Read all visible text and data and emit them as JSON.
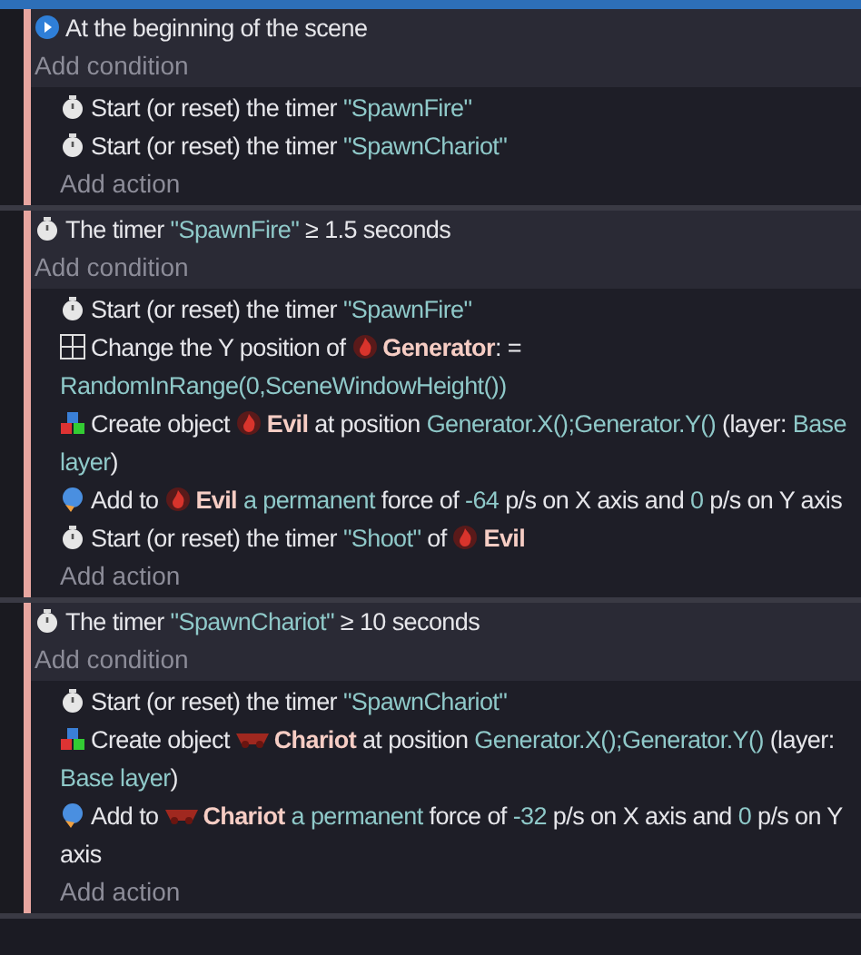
{
  "events": [
    {
      "conditions": [
        {
          "kind": "scene-start",
          "parts": [
            {
              "kind": "text",
              "text": "At the beginning of the scene"
            }
          ]
        }
      ],
      "add_condition": "Add condition",
      "actions": [
        {
          "kind": "timer",
          "parts": [
            {
              "kind": "text",
              "text": "Start (or reset) the timer "
            },
            {
              "kind": "value",
              "text": "\"SpawnFire\""
            }
          ]
        },
        {
          "kind": "timer",
          "parts": [
            {
              "kind": "text",
              "text": "Start (or reset) the timer "
            },
            {
              "kind": "value",
              "text": "\"SpawnChariot\""
            }
          ]
        }
      ],
      "add_action": "Add action"
    },
    {
      "conditions": [
        {
          "kind": "timer",
          "parts": [
            {
              "kind": "text",
              "text": "The timer "
            },
            {
              "kind": "value",
              "text": "\"SpawnFire\""
            },
            {
              "kind": "text",
              "text": " ≥ 1.5 seconds"
            }
          ]
        }
      ],
      "add_condition": "Add condition",
      "actions": [
        {
          "kind": "timer",
          "parts": [
            {
              "kind": "text",
              "text": "Start (or reset) the timer "
            },
            {
              "kind": "value",
              "text": "\"SpawnFire\""
            }
          ]
        },
        {
          "kind": "position",
          "parts": [
            {
              "kind": "text",
              "text": "Change the Y position of "
            },
            {
              "kind": "flame-object",
              "text": "Generator"
            },
            {
              "kind": "text",
              "text": ": = "
            },
            {
              "kind": "value",
              "text": "RandomInRange(0,SceneWindowHeight())"
            }
          ]
        },
        {
          "kind": "create",
          "parts": [
            {
              "kind": "text",
              "text": "Create object "
            },
            {
              "kind": "flame-object",
              "text": "Evil"
            },
            {
              "kind": "text",
              "text": " at position "
            },
            {
              "kind": "value",
              "text": "Generator.X();Generator.Y()"
            },
            {
              "kind": "text",
              "text": " (layer: "
            },
            {
              "kind": "value",
              "text": "Base layer"
            },
            {
              "kind": "text",
              "text": ")"
            }
          ]
        },
        {
          "kind": "force",
          "parts": [
            {
              "kind": "text",
              "text": "Add to "
            },
            {
              "kind": "flame-object",
              "text": "Evil"
            },
            {
              "kind": "value",
              "text": " a permanent"
            },
            {
              "kind": "text",
              "text": " force of "
            },
            {
              "kind": "value",
              "text": "-64"
            },
            {
              "kind": "text",
              "text": " p/s on X axis and "
            },
            {
              "kind": "value",
              "text": "0"
            },
            {
              "kind": "text",
              "text": " p/s on Y axis"
            }
          ]
        },
        {
          "kind": "timer",
          "parts": [
            {
              "kind": "text",
              "text": "Start (or reset) the timer "
            },
            {
              "kind": "value",
              "text": "\"Shoot\""
            },
            {
              "kind": "text",
              "text": " of "
            },
            {
              "kind": "flame-object",
              "text": "Evil"
            }
          ]
        }
      ],
      "add_action": "Add action"
    },
    {
      "conditions": [
        {
          "kind": "timer",
          "parts": [
            {
              "kind": "text",
              "text": "The timer "
            },
            {
              "kind": "value",
              "text": "\"SpawnChariot\""
            },
            {
              "kind": "text",
              "text": " ≥ 10 seconds"
            }
          ]
        }
      ],
      "add_condition": "Add condition",
      "actions": [
        {
          "kind": "timer",
          "parts": [
            {
              "kind": "text",
              "text": "Start (or reset) the timer "
            },
            {
              "kind": "value",
              "text": "\"SpawnChariot\""
            }
          ]
        },
        {
          "kind": "create",
          "parts": [
            {
              "kind": "text",
              "text": "Create object "
            },
            {
              "kind": "chariot-object",
              "text": "Chariot"
            },
            {
              "kind": "text",
              "text": " at position "
            },
            {
              "kind": "value",
              "text": "Generator.X();Generator.Y()"
            },
            {
              "kind": "text",
              "text": " (layer: "
            },
            {
              "kind": "value",
              "text": "Base layer"
            },
            {
              "kind": "text",
              "text": ")"
            }
          ]
        },
        {
          "kind": "force",
          "parts": [
            {
              "kind": "text",
              "text": "Add to "
            },
            {
              "kind": "chariot-object",
              "text": "Chariot"
            },
            {
              "kind": "value",
              "text": " a permanent"
            },
            {
              "kind": "text",
              "text": " force of "
            },
            {
              "kind": "value",
              "text": "-32"
            },
            {
              "kind": "text",
              "text": " p/s on X axis and "
            },
            {
              "kind": "value",
              "text": "0"
            },
            {
              "kind": "text",
              "text": " p/s on Y axis"
            }
          ]
        }
      ],
      "add_action": "Add action"
    }
  ]
}
